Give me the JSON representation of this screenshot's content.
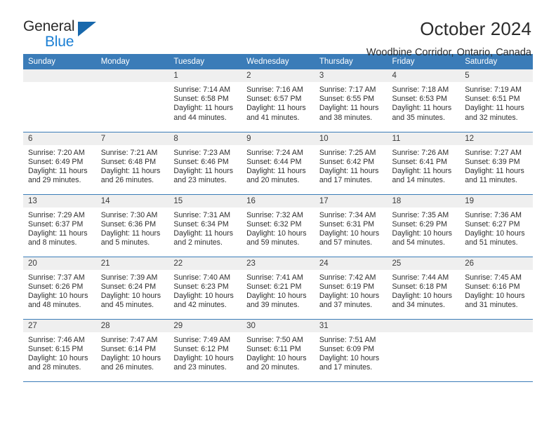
{
  "brand": {
    "name_part1": "General",
    "name_part2": "Blue",
    "triangle_color": "#1868ac",
    "blue_color": "#1b7fd4"
  },
  "header": {
    "title": "October 2024",
    "subtitle": "Woodbine Corridor, Ontario, Canada"
  },
  "theme": {
    "header_row_bg": "#3b7cb8",
    "daynum_bg": "#efefef",
    "text_color": "#2e2e2e"
  },
  "weekday_headers": [
    "Sunday",
    "Monday",
    "Tuesday",
    "Wednesday",
    "Thursday",
    "Friday",
    "Saturday"
  ],
  "weeks": [
    [
      {
        "day": "",
        "blank": true
      },
      {
        "day": "",
        "blank": true
      },
      {
        "day": "1",
        "sunrise": "Sunrise: 7:14 AM",
        "sunset": "Sunset: 6:58 PM",
        "daylight": "Daylight: 11 hours and 44 minutes."
      },
      {
        "day": "2",
        "sunrise": "Sunrise: 7:16 AM",
        "sunset": "Sunset: 6:57 PM",
        "daylight": "Daylight: 11 hours and 41 minutes."
      },
      {
        "day": "3",
        "sunrise": "Sunrise: 7:17 AM",
        "sunset": "Sunset: 6:55 PM",
        "daylight": "Daylight: 11 hours and 38 minutes."
      },
      {
        "day": "4",
        "sunrise": "Sunrise: 7:18 AM",
        "sunset": "Sunset: 6:53 PM",
        "daylight": "Daylight: 11 hours and 35 minutes."
      },
      {
        "day": "5",
        "sunrise": "Sunrise: 7:19 AM",
        "sunset": "Sunset: 6:51 PM",
        "daylight": "Daylight: 11 hours and 32 minutes."
      }
    ],
    [
      {
        "day": "6",
        "sunrise": "Sunrise: 7:20 AM",
        "sunset": "Sunset: 6:49 PM",
        "daylight": "Daylight: 11 hours and 29 minutes."
      },
      {
        "day": "7",
        "sunrise": "Sunrise: 7:21 AM",
        "sunset": "Sunset: 6:48 PM",
        "daylight": "Daylight: 11 hours and 26 minutes."
      },
      {
        "day": "8",
        "sunrise": "Sunrise: 7:23 AM",
        "sunset": "Sunset: 6:46 PM",
        "daylight": "Daylight: 11 hours and 23 minutes."
      },
      {
        "day": "9",
        "sunrise": "Sunrise: 7:24 AM",
        "sunset": "Sunset: 6:44 PM",
        "daylight": "Daylight: 11 hours and 20 minutes."
      },
      {
        "day": "10",
        "sunrise": "Sunrise: 7:25 AM",
        "sunset": "Sunset: 6:42 PM",
        "daylight": "Daylight: 11 hours and 17 minutes."
      },
      {
        "day": "11",
        "sunrise": "Sunrise: 7:26 AM",
        "sunset": "Sunset: 6:41 PM",
        "daylight": "Daylight: 11 hours and 14 minutes."
      },
      {
        "day": "12",
        "sunrise": "Sunrise: 7:27 AM",
        "sunset": "Sunset: 6:39 PM",
        "daylight": "Daylight: 11 hours and 11 minutes."
      }
    ],
    [
      {
        "day": "13",
        "sunrise": "Sunrise: 7:29 AM",
        "sunset": "Sunset: 6:37 PM",
        "daylight": "Daylight: 11 hours and 8 minutes."
      },
      {
        "day": "14",
        "sunrise": "Sunrise: 7:30 AM",
        "sunset": "Sunset: 6:36 PM",
        "daylight": "Daylight: 11 hours and 5 minutes."
      },
      {
        "day": "15",
        "sunrise": "Sunrise: 7:31 AM",
        "sunset": "Sunset: 6:34 PM",
        "daylight": "Daylight: 11 hours and 2 minutes."
      },
      {
        "day": "16",
        "sunrise": "Sunrise: 7:32 AM",
        "sunset": "Sunset: 6:32 PM",
        "daylight": "Daylight: 10 hours and 59 minutes."
      },
      {
        "day": "17",
        "sunrise": "Sunrise: 7:34 AM",
        "sunset": "Sunset: 6:31 PM",
        "daylight": "Daylight: 10 hours and 57 minutes."
      },
      {
        "day": "18",
        "sunrise": "Sunrise: 7:35 AM",
        "sunset": "Sunset: 6:29 PM",
        "daylight": "Daylight: 10 hours and 54 minutes."
      },
      {
        "day": "19",
        "sunrise": "Sunrise: 7:36 AM",
        "sunset": "Sunset: 6:27 PM",
        "daylight": "Daylight: 10 hours and 51 minutes."
      }
    ],
    [
      {
        "day": "20",
        "sunrise": "Sunrise: 7:37 AM",
        "sunset": "Sunset: 6:26 PM",
        "daylight": "Daylight: 10 hours and 48 minutes."
      },
      {
        "day": "21",
        "sunrise": "Sunrise: 7:39 AM",
        "sunset": "Sunset: 6:24 PM",
        "daylight": "Daylight: 10 hours and 45 minutes."
      },
      {
        "day": "22",
        "sunrise": "Sunrise: 7:40 AM",
        "sunset": "Sunset: 6:23 PM",
        "daylight": "Daylight: 10 hours and 42 minutes."
      },
      {
        "day": "23",
        "sunrise": "Sunrise: 7:41 AM",
        "sunset": "Sunset: 6:21 PM",
        "daylight": "Daylight: 10 hours and 39 minutes."
      },
      {
        "day": "24",
        "sunrise": "Sunrise: 7:42 AM",
        "sunset": "Sunset: 6:19 PM",
        "daylight": "Daylight: 10 hours and 37 minutes."
      },
      {
        "day": "25",
        "sunrise": "Sunrise: 7:44 AM",
        "sunset": "Sunset: 6:18 PM",
        "daylight": "Daylight: 10 hours and 34 minutes."
      },
      {
        "day": "26",
        "sunrise": "Sunrise: 7:45 AM",
        "sunset": "Sunset: 6:16 PM",
        "daylight": "Daylight: 10 hours and 31 minutes."
      }
    ],
    [
      {
        "day": "27",
        "sunrise": "Sunrise: 7:46 AM",
        "sunset": "Sunset: 6:15 PM",
        "daylight": "Daylight: 10 hours and 28 minutes."
      },
      {
        "day": "28",
        "sunrise": "Sunrise: 7:47 AM",
        "sunset": "Sunset: 6:14 PM",
        "daylight": "Daylight: 10 hours and 26 minutes."
      },
      {
        "day": "29",
        "sunrise": "Sunrise: 7:49 AM",
        "sunset": "Sunset: 6:12 PM",
        "daylight": "Daylight: 10 hours and 23 minutes."
      },
      {
        "day": "30",
        "sunrise": "Sunrise: 7:50 AM",
        "sunset": "Sunset: 6:11 PM",
        "daylight": "Daylight: 10 hours and 20 minutes."
      },
      {
        "day": "31",
        "sunrise": "Sunrise: 7:51 AM",
        "sunset": "Sunset: 6:09 PM",
        "daylight": "Daylight: 10 hours and 17 minutes."
      },
      {
        "day": "",
        "blank": true
      },
      {
        "day": "",
        "blank": true
      }
    ]
  ]
}
